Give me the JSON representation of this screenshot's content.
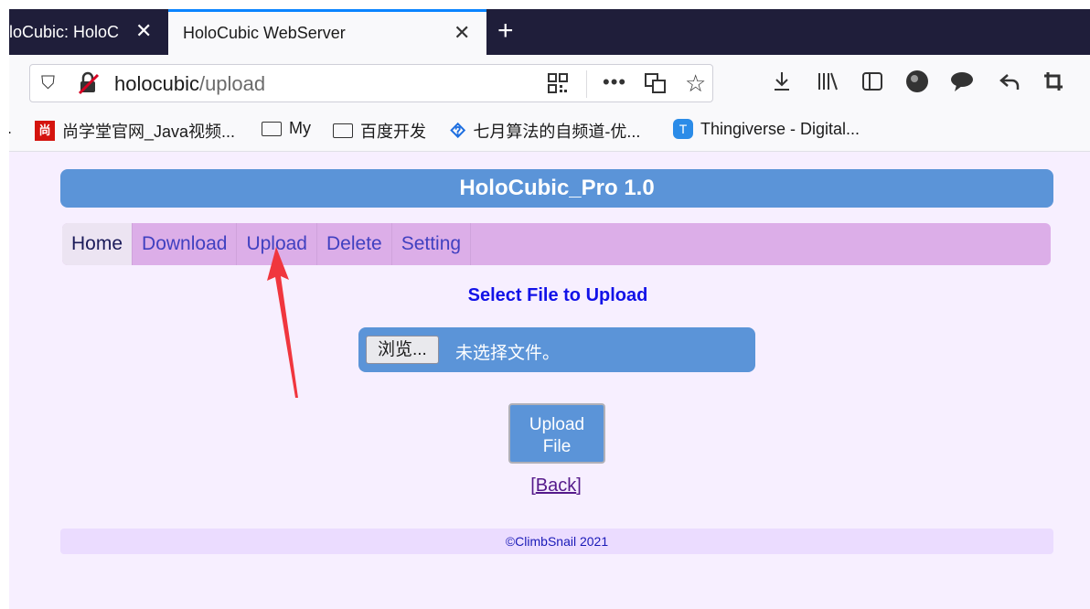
{
  "browser": {
    "tabs": [
      {
        "title": "loCubic: HoloC"
      },
      {
        "title": "HoloCubic WebServer"
      }
    ],
    "tab_close_glyph": "✕",
    "new_tab_glyph": "+",
    "url": {
      "host": "holocubic",
      "path": "/upload"
    },
    "url_more_glyph": "•••",
    "bookmarks": [
      {
        "label": "尚学堂官网_Java视频...",
        "icon": "shangxuetang-logo-icon",
        "icon_text": "尚"
      },
      {
        "label": "My",
        "icon": "folder-icon"
      },
      {
        "label": "百度开发",
        "icon": "folder-icon"
      },
      {
        "label": "七月算法的自频道-优...",
        "icon": "july-algo-icon"
      },
      {
        "label": "Thingiverse - Digital...",
        "icon": "thingiverse-icon",
        "icon_text": "T"
      }
    ]
  },
  "page": {
    "header_title": "HoloCubic_Pro 1.0",
    "menu": [
      "Home",
      "Download",
      "Upload",
      "Delete",
      "Setting"
    ],
    "select_label": "Select File to Upload",
    "browse_label": "浏览...",
    "file_status": "未选择文件。",
    "upload_button": {
      "line1": "Upload",
      "line2": "File"
    },
    "back_link": {
      "open": "[",
      "text": "Back",
      "close": "]"
    },
    "footer": "©ClimbSnail 2021"
  },
  "colors": {
    "header_bg": "#5b94d8",
    "menu_bg": "#dcaee8",
    "content_bg": "#f7efff",
    "footer_bg": "#ebdcff",
    "select_label": "#1212e8",
    "annotation_arrow": "#f0363e"
  }
}
